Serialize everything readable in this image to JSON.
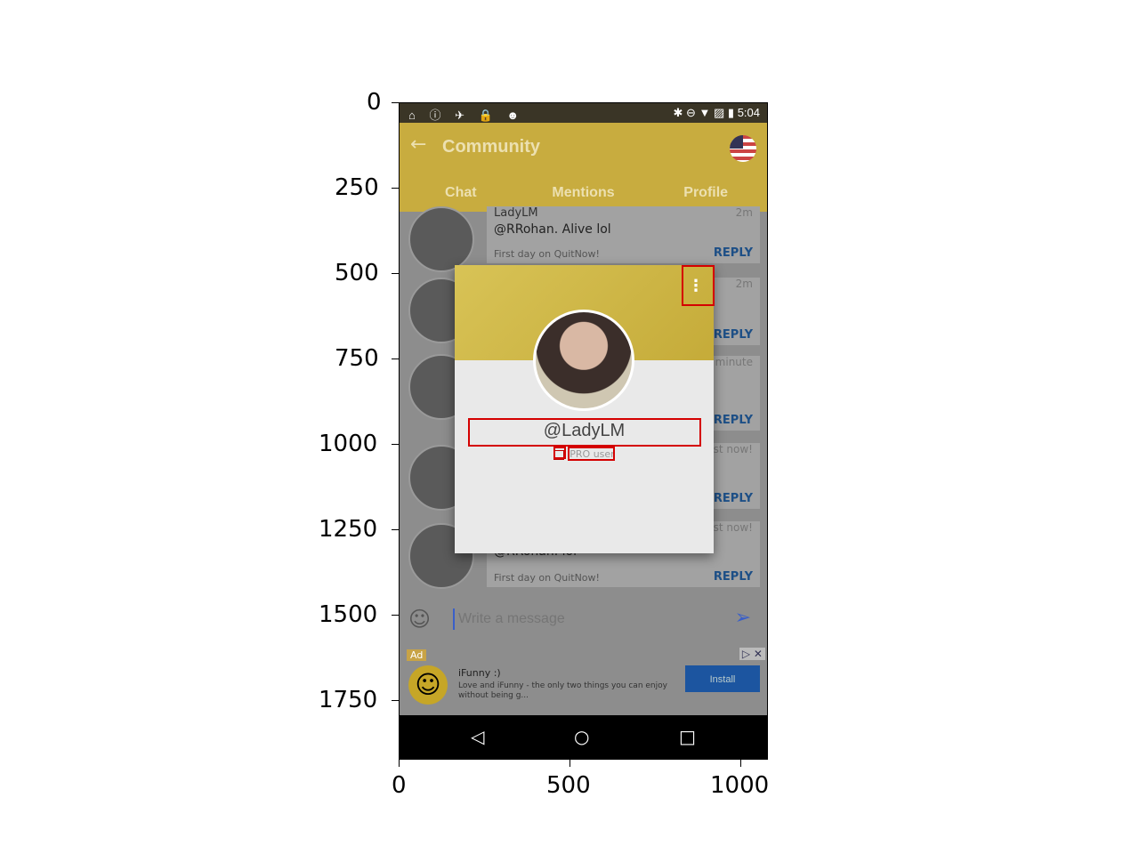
{
  "axes": {
    "y_ticks": [
      "0",
      "250",
      "500",
      "750",
      "1000",
      "1250",
      "1500",
      "1750"
    ],
    "x_ticks": [
      "0",
      "500",
      "1000"
    ]
  },
  "statusbar": {
    "time": "5:04",
    "left_icons": "⌂ ⓘ ✈ 🔒 ☻",
    "right_icons": "✱ ⊖ ▼ ▨ ▮"
  },
  "appbar": {
    "back_icon": "←",
    "title": "Community"
  },
  "tabs": [
    {
      "label": "Chat"
    },
    {
      "label": "Mentions"
    },
    {
      "label": "Profile"
    }
  ],
  "messages": [
    {
      "user": "LadyLM",
      "time": "2m",
      "text": "@RRohan. Alive lol",
      "sub": "First day on QuitNow!",
      "reply": "REPLY"
    },
    {
      "user": "",
      "time": "2m",
      "text": "",
      "sub": "",
      "reply": "REPLY"
    },
    {
      "user": "",
      "time": "a minute",
      "text": "",
      "sub": "",
      "reply": "REPLY"
    },
    {
      "user": "",
      "time": "just now!",
      "text": "",
      "sub": "",
      "reply": "REPLY"
    },
    {
      "user": "",
      "time": "just now!",
      "text": "@RRohan. lol",
      "sub": "First day on QuitNow!",
      "reply": "REPLY"
    }
  ],
  "composer": {
    "placeholder": "Write a message",
    "emoji_icon": "☺",
    "send_icon": "➢"
  },
  "ad": {
    "badge": "Ad",
    "title": "iFunny :)",
    "desc": "Love and iFunny - the only two things you can enjoy without being g...",
    "button": "Install",
    "logo": "☺",
    "close": "▷ ✕"
  },
  "navbar": {
    "back": "◁",
    "home": "○",
    "recent": "□"
  },
  "dialog": {
    "handle": "@LadyLM",
    "pro_label": "PRO user",
    "menu_icon": "⋮"
  },
  "colors": {
    "accent": "#c8ac3f",
    "reply": "#1d4f86",
    "highlight": "#d40000"
  }
}
